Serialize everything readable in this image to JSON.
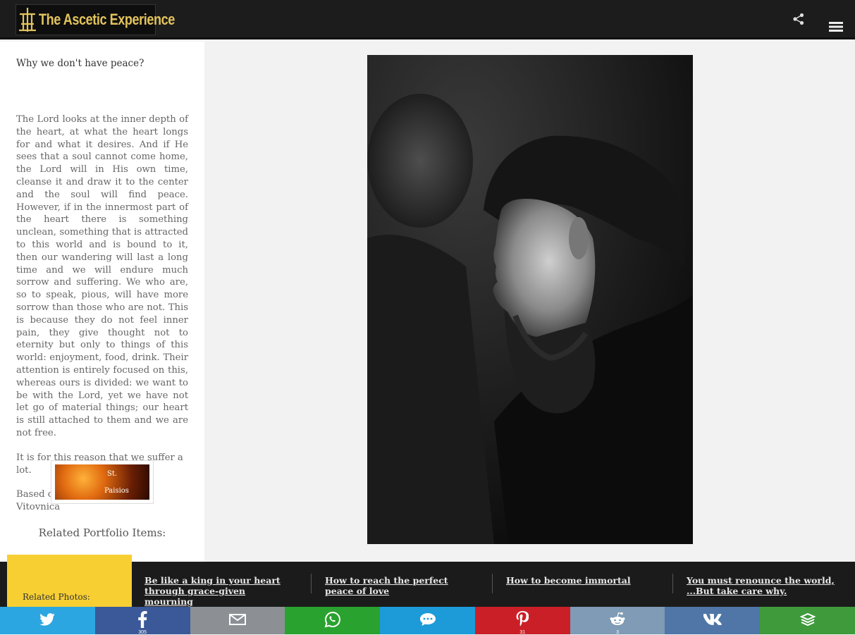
{
  "header": {
    "title": "The Ascetic Experience",
    "colors": {
      "background": "#1c1c1c",
      "logo_text": "#e2c35c"
    },
    "icons": [
      "logo-cross-icon",
      "share-icon",
      "menu-icon"
    ]
  },
  "article": {
    "title": "Why we don't have peace?",
    "body": "The Lord looks at the inner depth of the heart, at what the heart longs for and what it desires. And if He sees that a soul cannot come home, the Lord will in His own time, cleanse it and draw it to the center and the soul will find peace. However, if in the innermost part of the heart there is something unclean, something that is attracted to this world and is bound to it, then our wandering will last a long time and we will endure much sorrow and suffering. We who are, so to speak, pious, will have more sorrow than those who are not. This is because they do not feel inner pain, they give thought not to eternity but only to things of this world: enjoyment, food, drink. Their attention is entirely focused on this, whereas ours is divided: we want to be with the Lord, yet we have not let go of material things; our heart is still attached to them and we are not free.",
    "conclusion": "It is for this reason that we suffer a lot.",
    "source": "Based on Elder Thaddeus of Vitovnica",
    "related_title": "Related Portfolio Items:",
    "related_item": {
      "caption_line1": "St.",
      "caption_line2": "Paisios"
    }
  },
  "related_photos": {
    "label": "Related Photos:",
    "links": [
      "Be like a king in your heart through grace-given mourning",
      "How to reach the perfect peace of love",
      "How to become immortal",
      "You must renounce the world, ...But take care why."
    ],
    "colors": {
      "tag": "#f7cf33",
      "strip": "#1b1b1b"
    }
  },
  "share_bar": {
    "items": [
      {
        "name": "twitter",
        "icon": "twitter-icon",
        "color": "#2ca6e0",
        "count": ""
      },
      {
        "name": "facebook",
        "icon": "facebook-icon",
        "color": "#3b5998",
        "count": "305"
      },
      {
        "name": "email",
        "icon": "email-icon",
        "color": "#8c9095",
        "count": ""
      },
      {
        "name": "whatsapp",
        "icon": "whatsapp-icon",
        "color": "#2aa22f",
        "count": ""
      },
      {
        "name": "sms",
        "icon": "sms-icon",
        "color": "#1c9bd8",
        "count": ""
      },
      {
        "name": "pinterest",
        "icon": "pinterest-icon",
        "color": "#cb1f27",
        "count": "31"
      },
      {
        "name": "reddit",
        "icon": "reddit-icon",
        "color": "#7f9bb5",
        "count": "3"
      },
      {
        "name": "vk",
        "icon": "vk-icon",
        "color": "#4f76a6",
        "count": ""
      },
      {
        "name": "more",
        "icon": "more-share-icon",
        "color": "#3f9a3c",
        "count": ""
      }
    ]
  }
}
